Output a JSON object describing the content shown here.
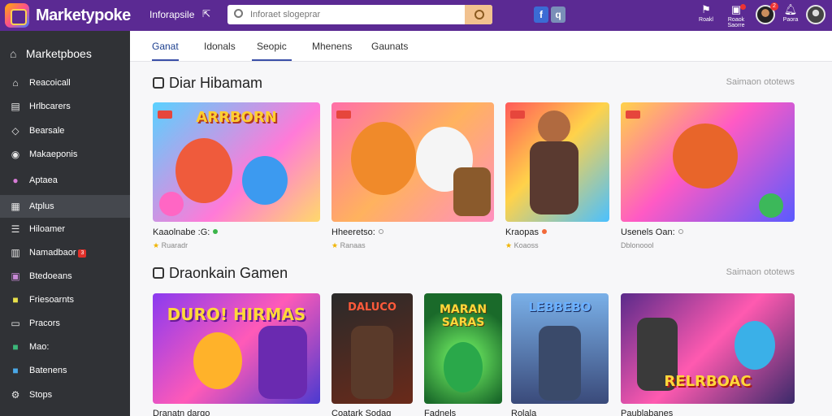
{
  "topbar": {
    "logo_text": "Marketypoke",
    "nav_link": "Inforapsile",
    "search_placeholder": "Inforaet slogeprar",
    "actions": [
      {
        "label": "Roakl",
        "icon": "flag-icon"
      },
      {
        "label": "Roaok Saorre",
        "icon": "gift-icon"
      },
      {
        "label": "Paora",
        "icon": "bell-icon"
      }
    ],
    "avatar_badge": "2"
  },
  "sidebar": {
    "heading": "Marketpboes",
    "items": [
      {
        "label": "Reacoicall",
        "icon": "home-icon"
      },
      {
        "label": "Hrlbcarers",
        "icon": "news-icon"
      },
      {
        "label": "Bearsale",
        "icon": "tag-icon"
      },
      {
        "label": "Makaeponis",
        "icon": "user-icon"
      },
      {
        "label": "Aptaea",
        "icon": "circle-icon"
      },
      {
        "label": "Atplus",
        "icon": "grid-icon",
        "active": true
      },
      {
        "label": "Hiloamer",
        "icon": "list-icon"
      },
      {
        "label": "Namadbaor",
        "icon": "chart-icon",
        "badge": "3"
      },
      {
        "label": "Btedoeans",
        "icon": "box-icon"
      },
      {
        "label": "Friesoarnts",
        "icon": "folder-icon"
      },
      {
        "label": "Pracors",
        "icon": "book-icon"
      },
      {
        "label": "Mao:",
        "icon": "map-icon"
      },
      {
        "label": "Batenens",
        "icon": "cart-icon"
      },
      {
        "label": "Stops",
        "icon": "gear-icon"
      }
    ]
  },
  "tabs": [
    {
      "label": "Ganat",
      "active": true
    },
    {
      "label": "Idonals"
    },
    {
      "label": "Seopic",
      "underlined": true
    },
    {
      "label": "Mhenens"
    },
    {
      "label": "Gaunats"
    }
  ],
  "sections": [
    {
      "title": "Diar Hibamam",
      "see_all": "Saimaon ototews",
      "cards": [
        {
          "art_text": "ARRBORN",
          "name": "Kaaolnabe :G:",
          "sub": "Ruaradr",
          "dot_color": "#3bb54a"
        },
        {
          "art_text": "",
          "name": "Hheeretso:",
          "sub": "Ranaas",
          "dot_color": "#999999"
        },
        {
          "art_text": "",
          "name": "Kraopas",
          "sub": "Koaoss",
          "dot_color": "#f26a3a"
        },
        {
          "art_text": "",
          "name": "Usenels Oan:",
          "sub": "Dblonoool",
          "dot_color": "#999999"
        }
      ]
    },
    {
      "title": "Draonkain Gamen",
      "see_all": "Saimaon ototews",
      "cards": [
        {
          "art_text": "DURO! HIRMAS",
          "name": "Dranatn dargo",
          "sub": "",
          "dot_color": "#e33"
        },
        {
          "art_text": "DALUCO",
          "name": "Coatark Sodag",
          "sub": "",
          "dot_color": "#999999"
        },
        {
          "art_text": "MARAN SARAS",
          "name": "Fadnels",
          "sub": "",
          "dot_color": "#999999"
        },
        {
          "art_text": "LEBBEBO",
          "name": "Rolala",
          "sub": "",
          "dot_color": "#999999"
        },
        {
          "art_text": "RELRBOAC",
          "name": "Paublabanes",
          "sub": "",
          "dot_color": "#999999"
        }
      ]
    }
  ],
  "colors": {
    "topbar": "#5b2a93",
    "sidebar": "#303236",
    "accent": "#3a4fa8"
  }
}
